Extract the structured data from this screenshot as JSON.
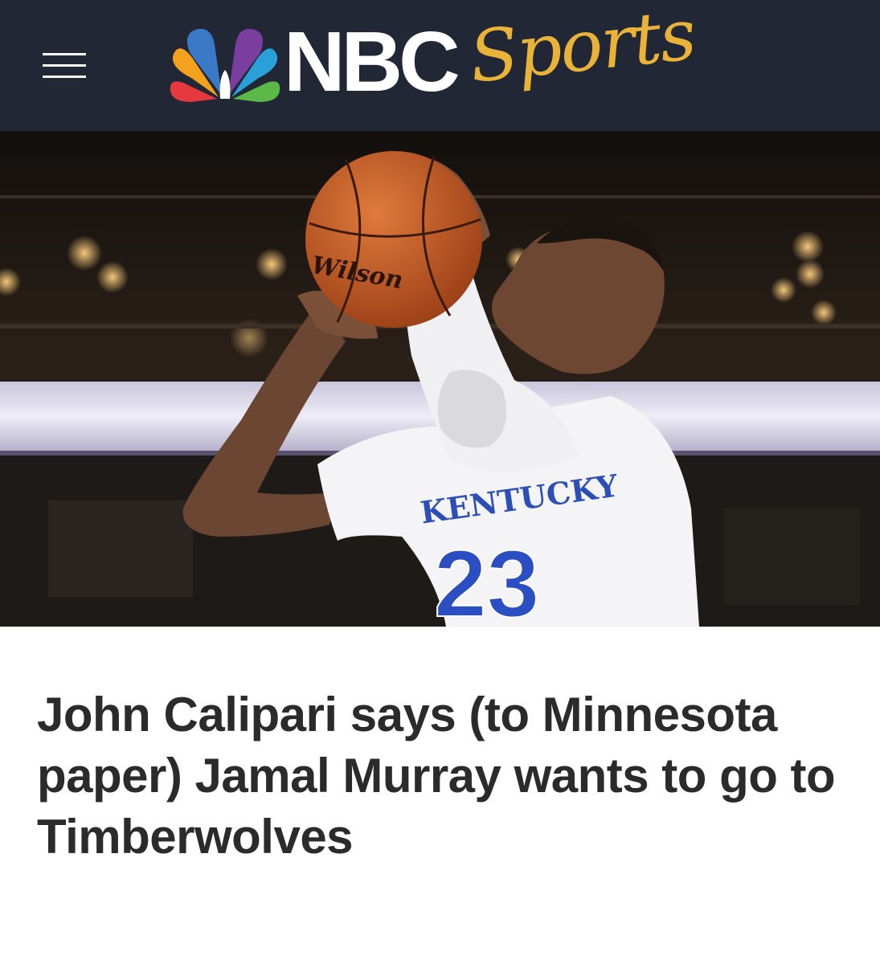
{
  "header": {
    "brand_name": "NBC",
    "brand_suffix": "Sports",
    "menu_icon": "hamburger-menu-icon",
    "logo_icon": "peacock-logo-icon",
    "background_color": "#222736",
    "accent_color": "#e9b33a"
  },
  "hero": {
    "jersey_wordmark": "KENTUCKY",
    "jersey_number": "23",
    "ball_brand": "Wilson"
  },
  "article": {
    "headline": "John Calipari says (to Minnesota paper) Jamal Murray wants to go to Timberwolves"
  }
}
